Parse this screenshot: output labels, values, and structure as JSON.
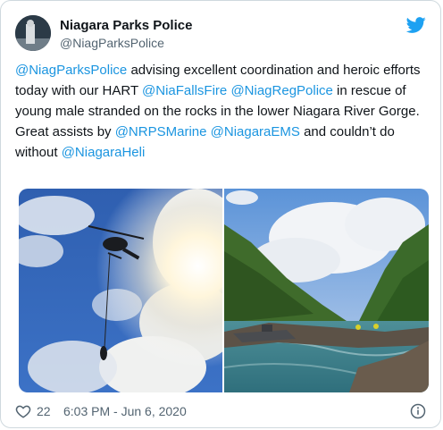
{
  "author": {
    "display_name": "Niagara Parks Police",
    "handle": "@NiagParksPolice"
  },
  "tweet": {
    "segments": [
      {
        "text": "@NiagParksPolice",
        "type": "mention"
      },
      {
        "text": " advising excellent coordination and heroic efforts today with our HART ",
        "type": "text"
      },
      {
        "text": "@NiaFallsFire",
        "type": "mention"
      },
      {
        "text": " ",
        "type": "text"
      },
      {
        "text": "@NiagRegPolice",
        "type": "mention"
      },
      {
        "text": " in rescue of young male stranded on the rocks in the lower Niagara River Gorge. Great assists by ",
        "type": "text"
      },
      {
        "text": "@NRPSMarine",
        "type": "mention"
      },
      {
        "text": " ",
        "type": "text"
      },
      {
        "text": "@NiagaraEMS",
        "type": "mention"
      },
      {
        "text": " and couldn’t do without ",
        "type": "text"
      },
      {
        "text": "@NiagaraHeli",
        "type": "mention"
      }
    ]
  },
  "footer": {
    "like_count": "22",
    "timestamp": "6:03 PM - Jun 6, 2020"
  },
  "icons": {
    "brand": "twitter-bird-icon",
    "like": "heart-icon",
    "info": "info-icon"
  },
  "colors": {
    "link": "#1b95e0",
    "brand": "#1da1f2",
    "text": "#0f1419",
    "muted": "#536471"
  }
}
